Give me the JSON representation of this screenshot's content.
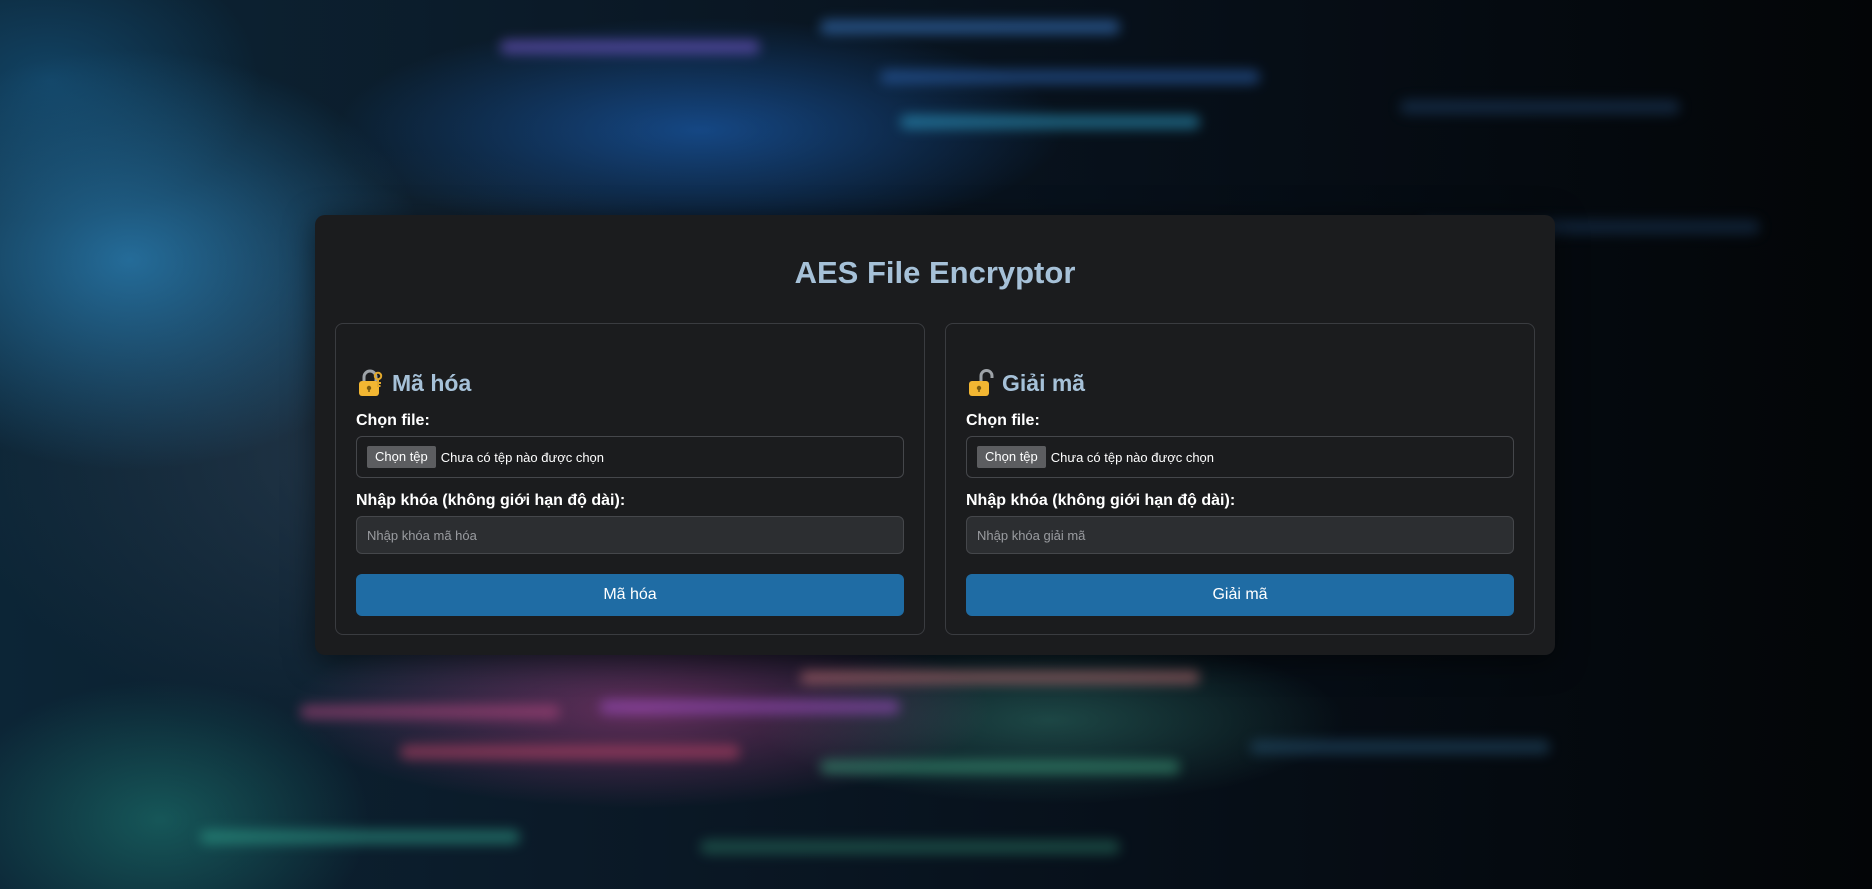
{
  "app": {
    "title": "AES File Encryptor"
  },
  "encrypt": {
    "icon": "lock-with-key-icon",
    "heading": "Mã hóa",
    "file_label": "Chọn file:",
    "file_button": "Chọn tệp",
    "file_status": "Chưa có tệp nào được chọn",
    "key_label": "Nhập khóa (không giới hạn độ dài):",
    "key_placeholder": "Nhập khóa mã hóa",
    "key_value": "",
    "submit_label": "Mã hóa"
  },
  "decrypt": {
    "icon": "open-lock-icon",
    "heading": "Giải mã",
    "file_label": "Chọn file:",
    "file_button": "Chọn tệp",
    "file_status": "Chưa có tệp nào được chọn",
    "key_label": "Nhập khóa (không giới hạn độ dài):",
    "key_placeholder": "Nhập khóa giải mã",
    "key_value": "",
    "submit_label": "Giải mã"
  },
  "colors": {
    "title": "#a6c1d8",
    "panel": "#1b1c1e",
    "button": "#1f6ca4",
    "input": "#2c2e31"
  }
}
